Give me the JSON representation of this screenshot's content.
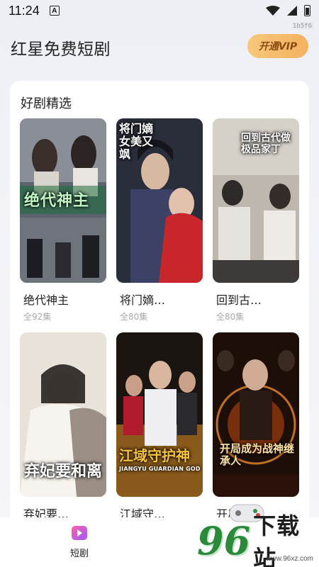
{
  "status_bar": {
    "time": "11:24",
    "a_icon": "A",
    "corner_tag": "1b5f6"
  },
  "header": {
    "title": "红星免费短剧",
    "vip_label": "开通VIP"
  },
  "section": {
    "title": "好剧精选",
    "dramas": [
      {
        "title": "绝代神主",
        "count": "全92集",
        "poster_text": "绝代神主",
        "icon": "poster-1"
      },
      {
        "title": "将门嫡…",
        "count": "全80集",
        "poster_text": "将门嫡女美又飒",
        "icon": "poster-2"
      },
      {
        "title": "回到古…",
        "count": "全80集",
        "poster_text": "回到古代做极品家丁",
        "icon": "poster-3"
      },
      {
        "title": "弃妃要…",
        "count": "",
        "poster_text": "弃妃要和离",
        "icon": "poster-4"
      },
      {
        "title": "江域守…",
        "count": "",
        "poster_text": "江域守护神",
        "poster_sub": "JIANGYU GUARDIAN GOD",
        "icon": "poster-5"
      },
      {
        "title": "开局成…",
        "count": "",
        "poster_text": "开局成为战神继承人",
        "icon": "poster-6"
      }
    ]
  },
  "bottom_nav": {
    "items": [
      {
        "label": "短剧",
        "icon": "drama-play-icon"
      }
    ]
  },
  "watermark": {
    "num": "96",
    "text": "下载站",
    "url": "www.96xz.com"
  },
  "colors": {
    "vip_gold": "#f3b25e",
    "card_bg": "#ffffff",
    "watermark_green": "#2a8a3a"
  }
}
